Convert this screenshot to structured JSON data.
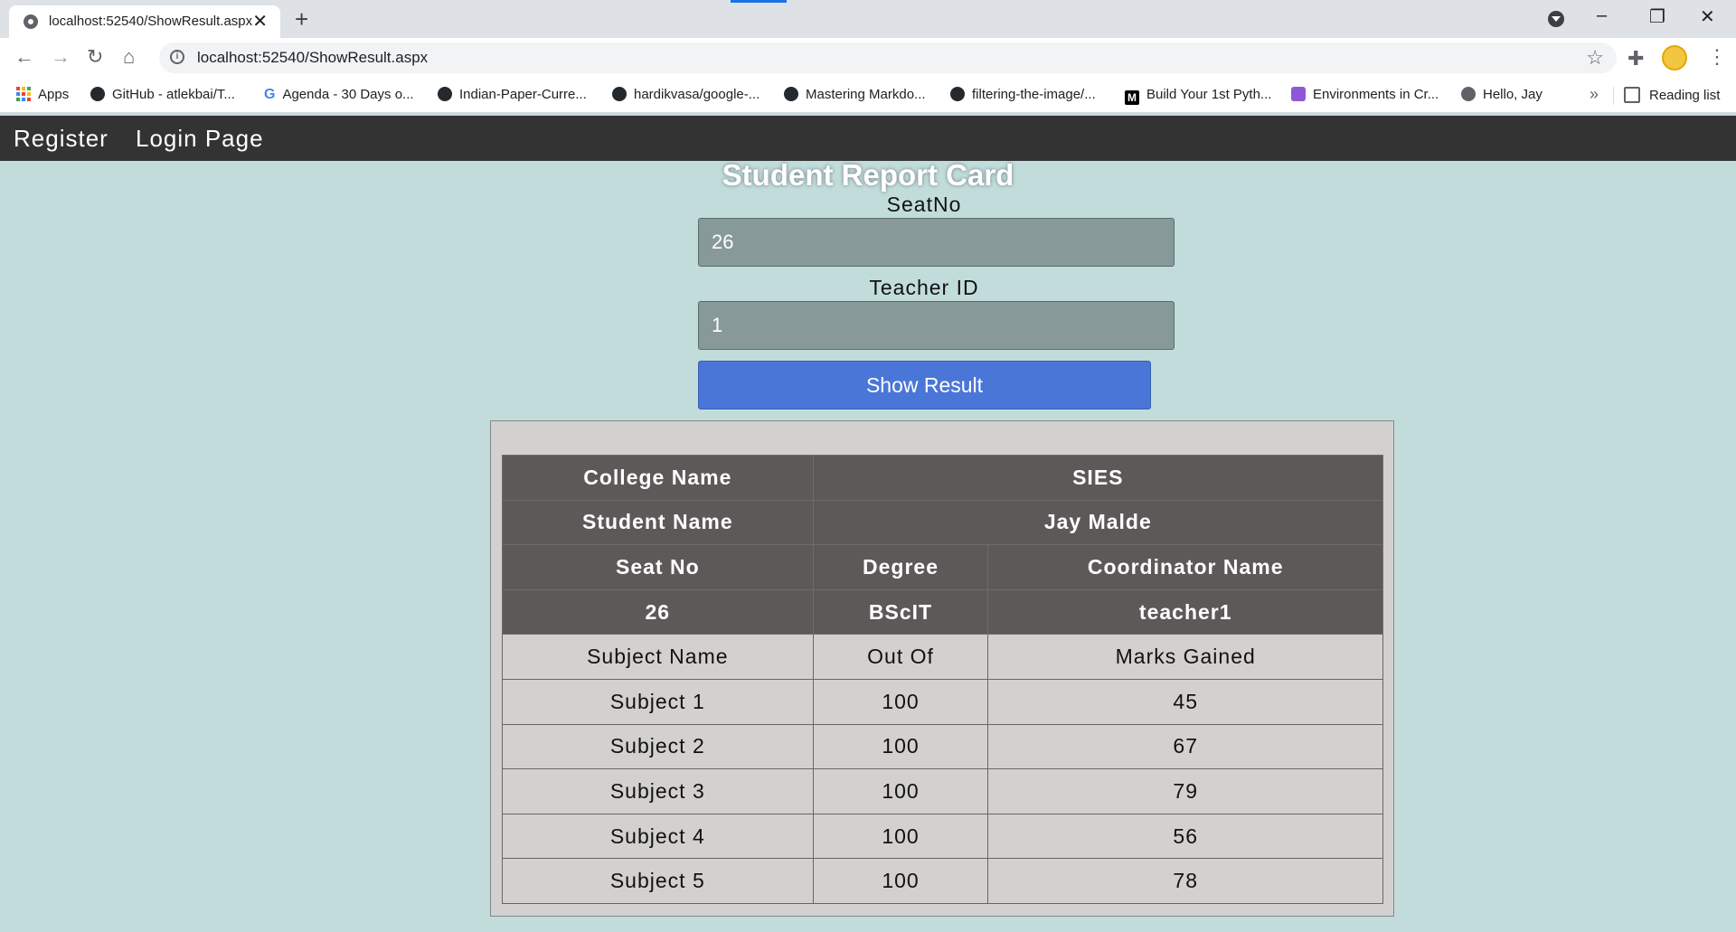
{
  "browser": {
    "tab_title": "localhost:52540/ShowResult.aspx",
    "url": "localhost:52540/ShowResult.aspx",
    "bookmarks": [
      {
        "label": "Apps",
        "icon": "apps-icon"
      },
      {
        "label": "GitHub - atlekbai/T...",
        "icon": "github-icon"
      },
      {
        "label": "Agenda - 30 Days o...",
        "icon": "google-icon"
      },
      {
        "label": "Indian-Paper-Curre...",
        "icon": "github-icon"
      },
      {
        "label": "hardikvasa/google-...",
        "icon": "github-icon"
      },
      {
        "label": "Mastering Markdo...",
        "icon": "github-icon"
      },
      {
        "label": "filtering-the-image/...",
        "icon": "github-icon"
      },
      {
        "label": "Build Your 1st Pyth...",
        "icon": "medium-icon"
      },
      {
        "label": "Environments in Cr...",
        "icon": "cloud-icon"
      },
      {
        "label": "Hello, Jay",
        "icon": "globe-icon"
      }
    ],
    "reading_list": "Reading list"
  },
  "navbar": {
    "register": "Register",
    "login": "Login Page"
  },
  "form": {
    "title": "Student Report Card",
    "seat_label": "SeatNo",
    "seat_value": "26",
    "teacher_label": "Teacher ID",
    "teacher_value": "1",
    "button_label": "Show Result"
  },
  "report": {
    "college_label": "College Name",
    "college_value": "SIES",
    "student_label": "Student Name",
    "student_value": "Jay Malde",
    "seat_header": "Seat No",
    "degree_header": "Degree",
    "coordinator_header": "Coordinator Name",
    "seat_no": "26",
    "degree": "BScIT",
    "coordinator": "teacher1",
    "subject_header": "Subject Name",
    "outof_header": "Out Of",
    "marks_header": "Marks Gained",
    "subjects": [
      {
        "name": "Subject 1",
        "out_of": "100",
        "marks": "45"
      },
      {
        "name": "Subject 2",
        "out_of": "100",
        "marks": "67"
      },
      {
        "name": "Subject 3",
        "out_of": "100",
        "marks": "79"
      },
      {
        "name": "Subject 4",
        "out_of": "100",
        "marks": "56"
      },
      {
        "name": "Subject 5",
        "out_of": "100",
        "marks": "78"
      }
    ]
  },
  "colors": {
    "page_bg": "#c2dcdc",
    "navbar_bg": "#333333",
    "button_bg": "#4a76d8",
    "field_bg": "#879999",
    "header_cell_bg": "#5d5959"
  }
}
